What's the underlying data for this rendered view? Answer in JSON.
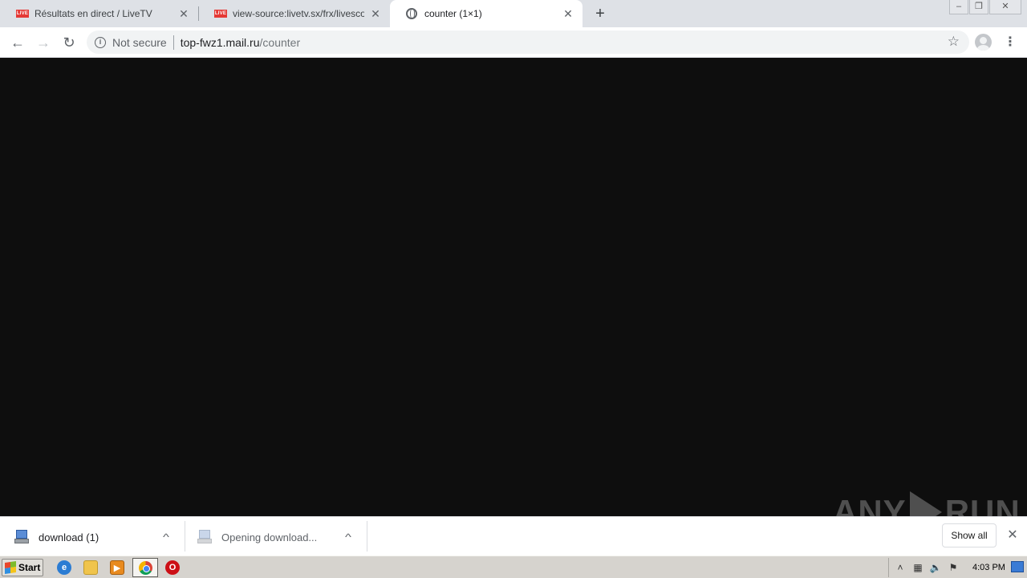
{
  "tabs": [
    {
      "title": "Résultats en direct / LiveTV",
      "favicon": "live-icon",
      "favicon_text": "LIVE"
    },
    {
      "title": "view-source:livetv.sx/frx/livescore/",
      "favicon": "live-icon",
      "favicon_text": "LIVE"
    },
    {
      "title": "counter (1×1)",
      "favicon": "globe-icon",
      "active": true
    }
  ],
  "toolbar": {
    "security_label": "Not secure",
    "url_host": "top-fwz1.mail.ru",
    "url_path": "/counter"
  },
  "downloads": [
    {
      "name": "download (1)",
      "state": "complete"
    },
    {
      "name": "Opening download...",
      "state": "opening"
    }
  ],
  "shelf": {
    "show_all_label": "Show all"
  },
  "watermark": {
    "left": "ANY",
    "right": "RUN"
  },
  "taskbar": {
    "start_label": "Start",
    "clock": "4:03 PM",
    "pinned": [
      "ie-icon",
      "folder-icon",
      "media-player-icon",
      "chrome-icon",
      "opera-icon"
    ]
  },
  "colors": {
    "content_background": "#0e0e0e",
    "active_tab": "#ffffff",
    "tabstrip": "#dee1e6"
  }
}
